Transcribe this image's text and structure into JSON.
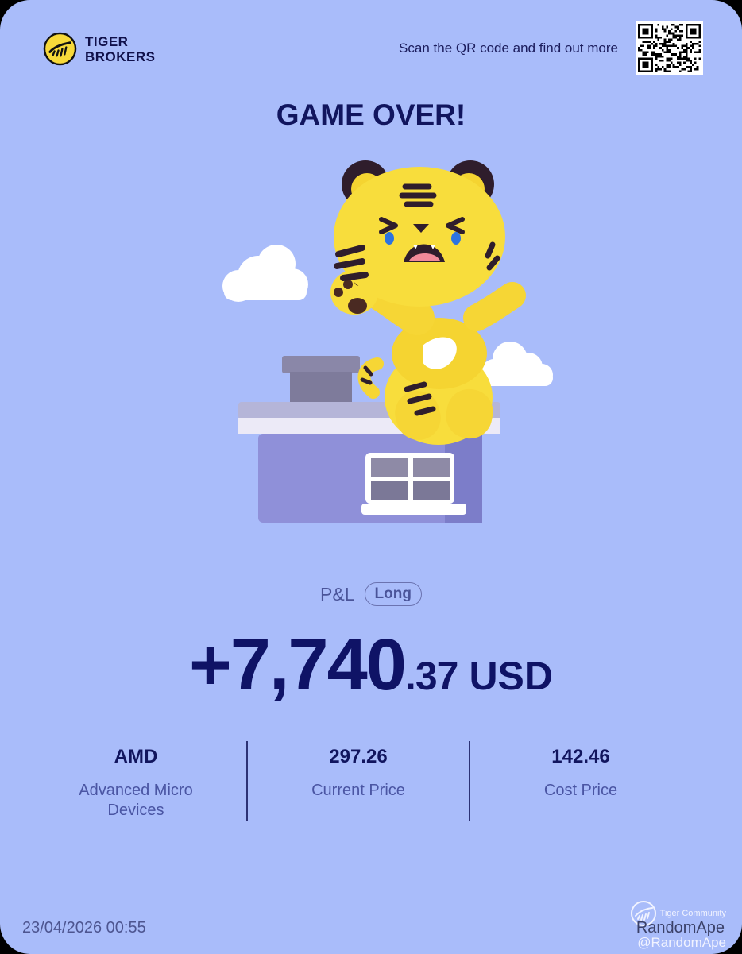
{
  "brand": {
    "name_line1": "TIGER",
    "name_line2": "BROKERS"
  },
  "header": {
    "scan_text": "Scan the QR code and find out more"
  },
  "title": "GAME OVER!",
  "pnl": {
    "label": "P&L",
    "position_type": "Long",
    "amount_main": "+7,740",
    "amount_decimal": ".37",
    "currency": "USD"
  },
  "stats": [
    {
      "value": "AMD",
      "label": "Advanced Micro Devices"
    },
    {
      "value": "297.26",
      "label": "Current Price"
    },
    {
      "value": "142.46",
      "label": "Cost Price"
    }
  ],
  "footer": {
    "timestamp": "23/04/2026 00:55",
    "watermark_community": "Tiger Community",
    "watermark_user": "RandomApe",
    "watermark_handle": "@RandomApe"
  },
  "icons": {
    "logo": "tiger-logo-icon",
    "qr": "qr-code-icon",
    "watermark": "tiger-community-icon"
  },
  "colors": {
    "background": "#a9bcfa",
    "primary_text": "#11155e",
    "accent_yellow": "#f7d93a"
  }
}
